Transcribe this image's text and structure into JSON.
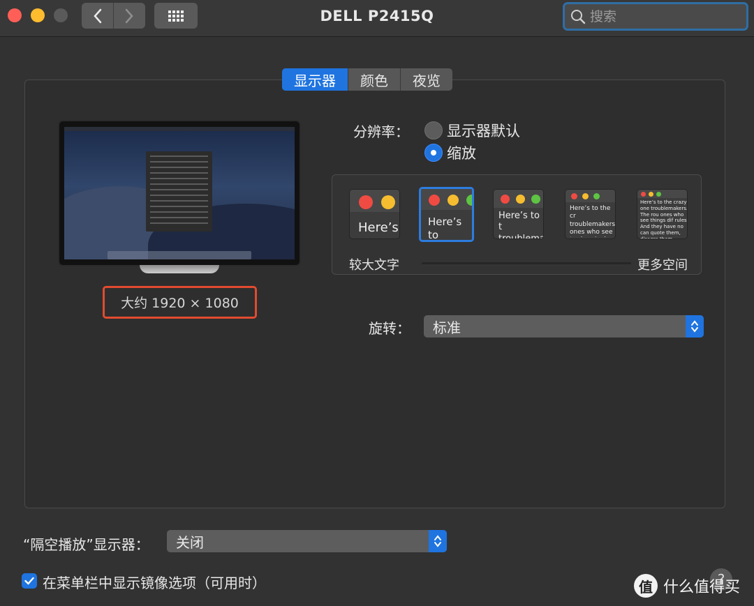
{
  "window": {
    "title": "DELL P2415Q",
    "search_placeholder": "搜索"
  },
  "tabs": [
    {
      "label": "显示器",
      "active": true
    },
    {
      "label": "颜色",
      "active": false
    },
    {
      "label": "夜览",
      "active": false
    }
  ],
  "display": {
    "resolution_text": "大约 1920 × 1080",
    "resolution_label": "分辨率：",
    "options": [
      {
        "label": "显示器默认",
        "selected": false
      },
      {
        "label": "缩放",
        "selected": true
      }
    ],
    "scaling": {
      "left_caption": "较大文字",
      "right_caption": "更多空间",
      "thumbnails": [
        {
          "text": "Here’s",
          "selected": false
        },
        {
          "text": "Here’s to troublem",
          "selected": true
        },
        {
          "text": "Here’s to t troublema ones who",
          "selected": false
        },
        {
          "text": "Here’s to the cr troublemakers. ones who see t rules. And they",
          "selected": false
        },
        {
          "text": "Here’s to the crazy one troublemakers. The rou ones who see things dif rules. And they have no can quote them, disagre them. About the only th Because they change th",
          "selected": false
        }
      ]
    },
    "rotation_label": "旋转：",
    "rotation_value": "标准"
  },
  "airplay": {
    "label": "“隔空播放”显示器：",
    "value": "关闭"
  },
  "mirror_option": {
    "label": "在菜单栏中显示镜像选项（可用时）",
    "checked": true
  },
  "help_label": "?",
  "watermark": {
    "logo_text": "值",
    "text": "什么值得买"
  },
  "colors": {
    "accent": "#1f74e0",
    "highlight_box": "#e24b30"
  }
}
